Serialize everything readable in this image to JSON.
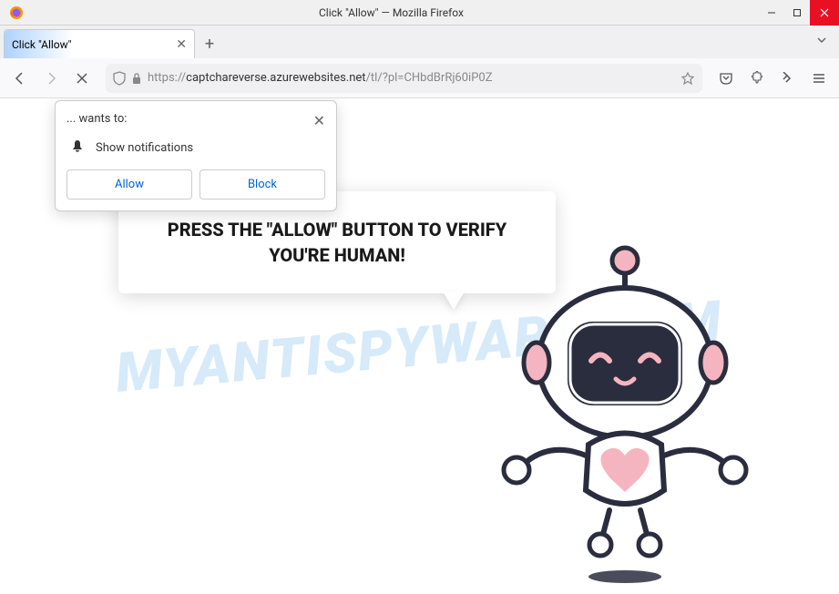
{
  "window": {
    "title": "Click \"Allow\" — Mozilla Firefox"
  },
  "tabs": [
    {
      "label": "Click \"Allow\""
    }
  ],
  "urlbar": {
    "protocol": "https://",
    "domain": "captchareverse.azurewebsites.net",
    "path": "/tl/?pl=CHbdBrRj60iP0Z"
  },
  "permission_popup": {
    "wants": "... wants to:",
    "notification_text": "Show notifications",
    "allow_label": "Allow",
    "block_label": "Block"
  },
  "speech": {
    "text": "PRESS THE \"ALLOW\" BUTTON TO VERIFY YOU'RE HUMAN!"
  },
  "watermark": {
    "text": "MYANTISPYWARE.COM"
  }
}
